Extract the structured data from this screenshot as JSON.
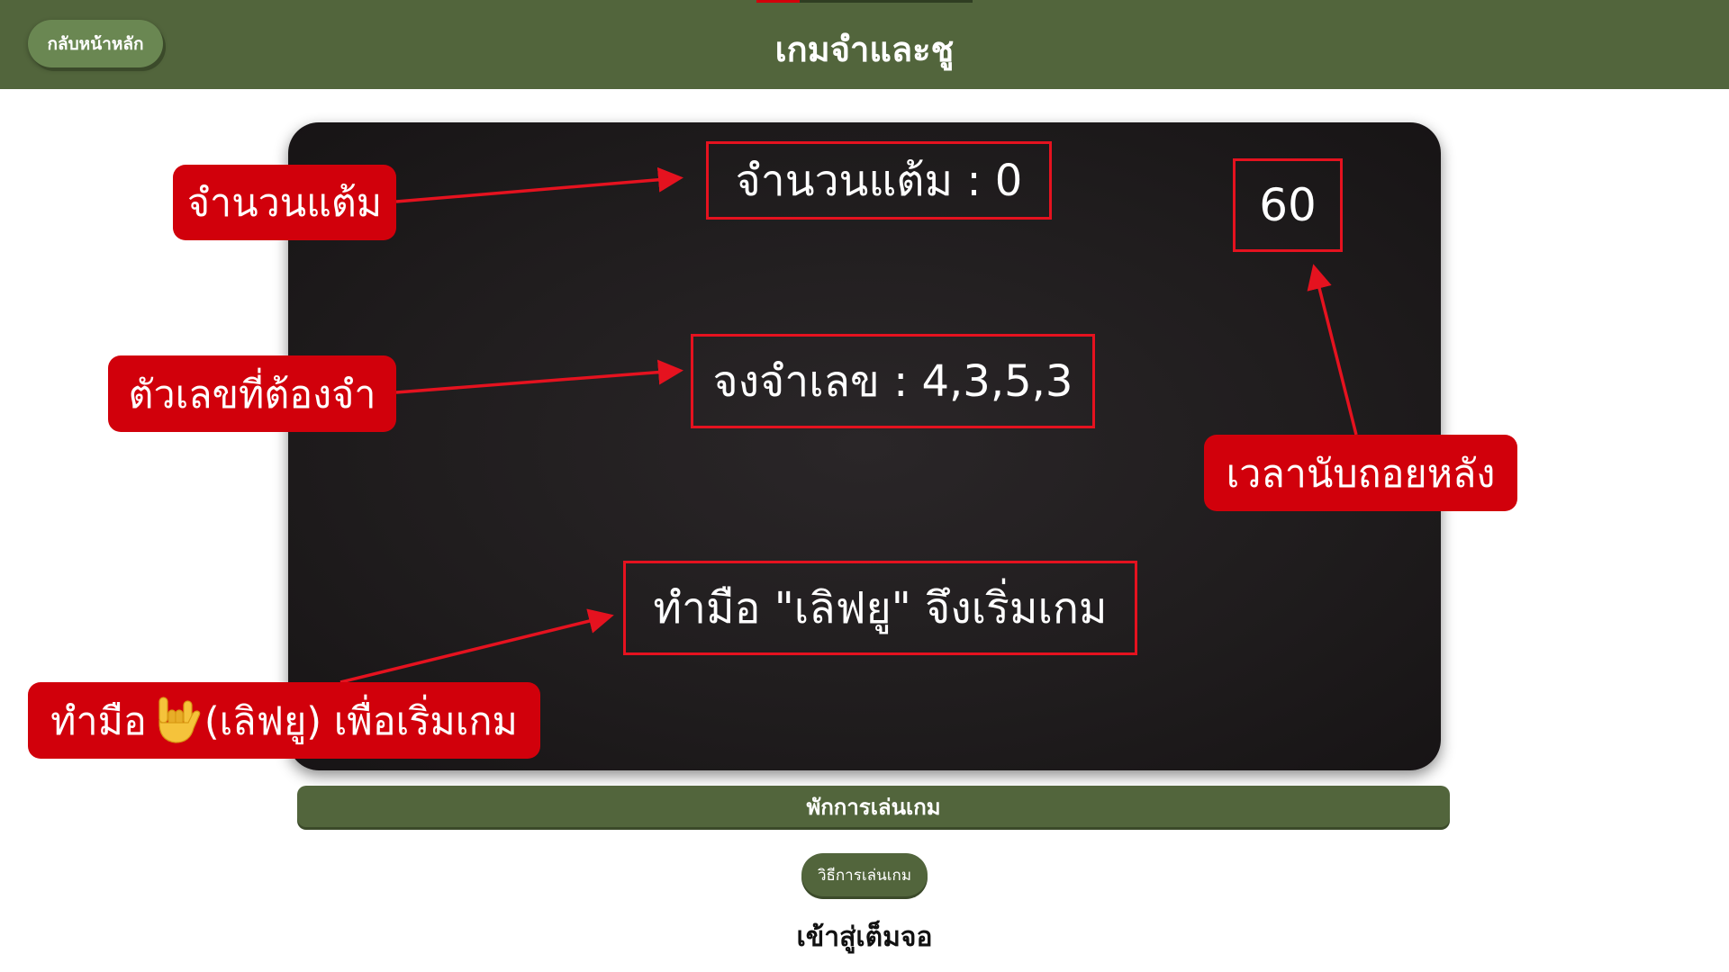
{
  "header": {
    "title": "เกมจำและชู",
    "home_button": "กลับหน้าหลัก",
    "background": "#52653c",
    "tab_indicator_colors": [
      "#d1000b",
      "#2f3d22"
    ]
  },
  "game": {
    "score_text": "จำนวนแต้ม : 0",
    "memorize_text": "จงจำเลข : 4,3,5,3",
    "countdown": "60",
    "instruction_text": "ทำมือ \"เลิฟยู\" จึงเริ่มเกม"
  },
  "callouts": {
    "score": "จำนวนแต้ม",
    "numbers": "ตัวเลขที่ต้องจำ",
    "timer": "เวลานับถอยหลัง",
    "start_prefix": "ทำมือ",
    "start_suffix": "(เลิฟยู) เพื่อเริ่มเกม",
    "start_icon": "love-you-hand-emoji",
    "color": "#d1000b"
  },
  "controls": {
    "pause": "พักการเล่นเกม",
    "how_to_play": "วิธีการเล่นเกม",
    "fullscreen": "เข้าสู่เต็มจอ"
  }
}
